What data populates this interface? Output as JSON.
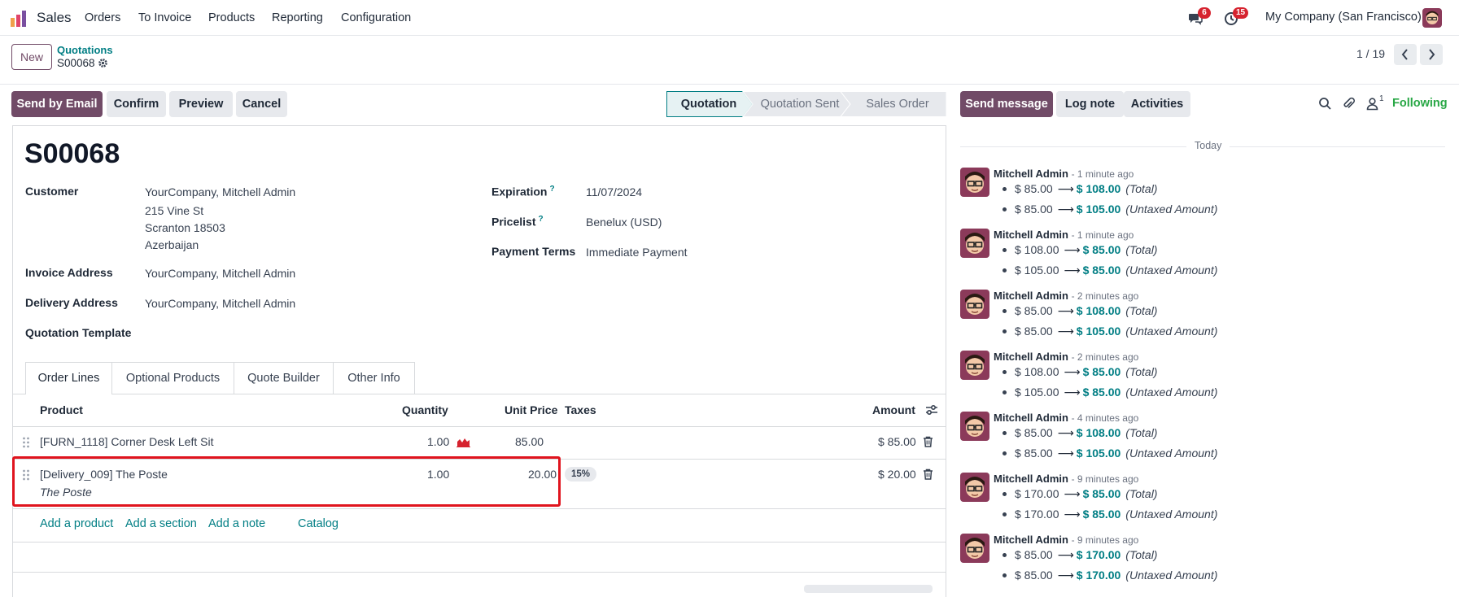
{
  "topbar": {
    "app_name": "Sales",
    "menu": [
      "Orders",
      "To Invoice",
      "Products",
      "Reporting",
      "Configuration"
    ],
    "messages_badge": "6",
    "activities_badge": "15",
    "company": "My Company (San Francisco)"
  },
  "control_panel": {
    "new_label": "New",
    "breadcrumb_parent": "Quotations",
    "breadcrumb_current": "S00068",
    "pager": "1 / 19"
  },
  "actions": {
    "send_email": "Send by Email",
    "confirm": "Confirm",
    "preview": "Preview",
    "cancel": "Cancel"
  },
  "status_bar": [
    "Quotation",
    "Quotation Sent",
    "Sales Order"
  ],
  "status_active": "Quotation",
  "form": {
    "name": "S00068",
    "customer_label": "Customer",
    "customer_name": "YourCompany, Mitchell Admin",
    "customer_street": "215 Vine St",
    "customer_city": "Scranton 18503",
    "customer_country": "Azerbaijan",
    "invoice_label": "Invoice Address",
    "invoice_value": "YourCompany, Mitchell Admin",
    "delivery_label": "Delivery Address",
    "delivery_value": "YourCompany, Mitchell Admin",
    "template_label": "Quotation Template",
    "expiration_label": "Expiration",
    "expiration_value": "11/07/2024",
    "pricelist_label": "Pricelist",
    "pricelist_value": "Benelux (USD)",
    "terms_label": "Payment Terms",
    "terms_value": "Immediate Payment",
    "help_mark": "?"
  },
  "tabs": [
    "Order Lines",
    "Optional Products",
    "Quote Builder",
    "Other Info"
  ],
  "lines_table": {
    "headers": {
      "product": "Product",
      "quantity": "Quantity",
      "unit_price": "Unit Price",
      "taxes": "Taxes",
      "amount": "Amount"
    },
    "rows": [
      {
        "product": "[FURN_1118] Corner Desk Left Sit",
        "description": "",
        "quantity": "1.00",
        "unit_price": "85.00",
        "tax": "",
        "amount": "$ 85.00"
      },
      {
        "product": "[Delivery_009] The Poste",
        "description": "The Poste",
        "quantity": "1.00",
        "unit_price": "20.00",
        "tax": "15%",
        "amount": "$ 20.00"
      }
    ],
    "add_product": "Add a product",
    "add_section": "Add a section",
    "add_note": "Add a note",
    "catalog": "Catalog"
  },
  "chatter": {
    "send_message": "Send message",
    "log_note": "Log note",
    "activities": "Activities",
    "followers_count": "1",
    "following": "Following",
    "today": "Today",
    "messages": [
      {
        "author": "Mitchell Admin",
        "time": "- 1 minute ago",
        "changes": [
          {
            "old": "$ 85.00",
            "new": "$ 108.00",
            "field": "(Total)"
          },
          {
            "old": "$ 85.00",
            "new": "$ 105.00",
            "field": "(Untaxed Amount)"
          }
        ]
      },
      {
        "author": "Mitchell Admin",
        "time": "- 1 minute ago",
        "changes": [
          {
            "old": "$ 108.00",
            "new": "$ 85.00",
            "field": "(Total)"
          },
          {
            "old": "$ 105.00",
            "new": "$ 85.00",
            "field": "(Untaxed Amount)"
          }
        ]
      },
      {
        "author": "Mitchell Admin",
        "time": "- 2 minutes ago",
        "changes": [
          {
            "old": "$ 85.00",
            "new": "$ 108.00",
            "field": "(Total)"
          },
          {
            "old": "$ 85.00",
            "new": "$ 105.00",
            "field": "(Untaxed Amount)"
          }
        ]
      },
      {
        "author": "Mitchell Admin",
        "time": "- 2 minutes ago",
        "changes": [
          {
            "old": "$ 108.00",
            "new": "$ 85.00",
            "field": "(Total)"
          },
          {
            "old": "$ 105.00",
            "new": "$ 85.00",
            "field": "(Untaxed Amount)"
          }
        ]
      },
      {
        "author": "Mitchell Admin",
        "time": "- 4 minutes ago",
        "changes": [
          {
            "old": "$ 85.00",
            "new": "$ 108.00",
            "field": "(Total)"
          },
          {
            "old": "$ 85.00",
            "new": "$ 105.00",
            "field": "(Untaxed Amount)"
          }
        ]
      },
      {
        "author": "Mitchell Admin",
        "time": "- 9 minutes ago",
        "changes": [
          {
            "old": "$ 170.00",
            "new": "$ 85.00",
            "field": "(Total)"
          },
          {
            "old": "$ 170.00",
            "new": "$ 85.00",
            "field": "(Untaxed Amount)"
          }
        ]
      },
      {
        "author": "Mitchell Admin",
        "time": "- 9 minutes ago",
        "changes": [
          {
            "old": "$ 85.00",
            "new": "$ 170.00",
            "field": "(Total)"
          },
          {
            "old": "$ 85.00",
            "new": "$ 170.00",
            "field": "(Untaxed Amount)"
          }
        ]
      }
    ]
  },
  "colors": {
    "brand": "#714b67",
    "link": "#017e84",
    "following": "#28a745",
    "badge": "#d6232f",
    "highlight": "#e0141e"
  }
}
